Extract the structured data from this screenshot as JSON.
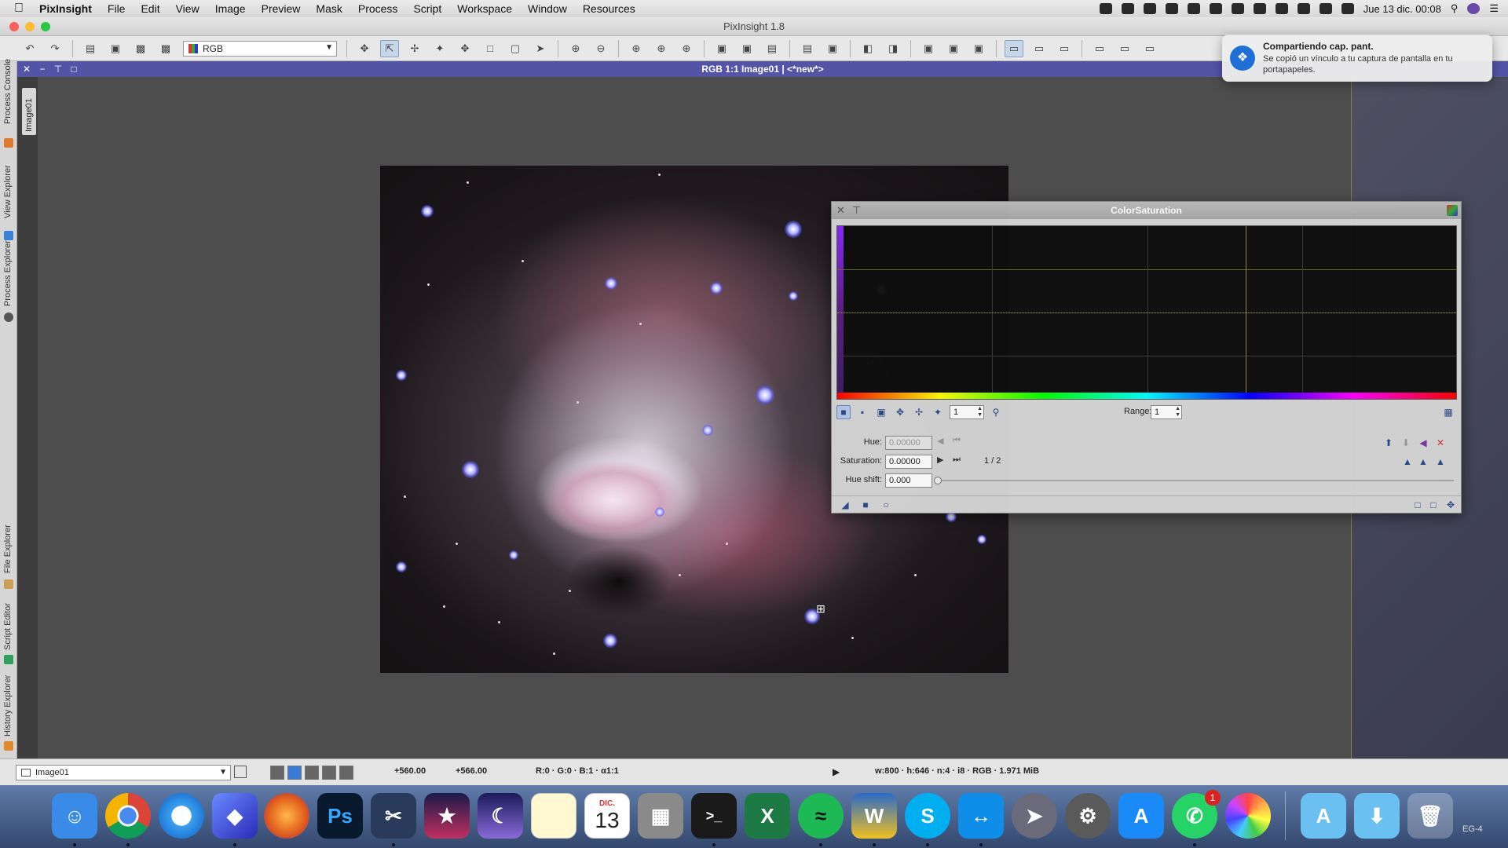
{
  "menubar": {
    "app": "PixInsight",
    "items": [
      "File",
      "Edit",
      "View",
      "Image",
      "Preview",
      "Mask",
      "Process",
      "Script",
      "Workspace",
      "Window",
      "Resources"
    ],
    "clock": "Jue 13 dic.  00:08"
  },
  "window": {
    "title": "PixInsight 1.8"
  },
  "toolbar": {
    "color_mode": "RGB"
  },
  "left_tabs": [
    "Process Console",
    "View Explorer",
    "Process Explorer",
    "File Explorer",
    "Script Editor",
    "History Explorer"
  ],
  "image_tab": "Image01",
  "image_window": {
    "title": "RGB 1:1 Image01 | <*new*>"
  },
  "dialog": {
    "title": "ColorSaturation",
    "zoom_value": "1",
    "range_label": "Range:",
    "range_value": "1",
    "hue_label": "Hue:",
    "hue_value": "0.00000",
    "saturation_label": "Saturation:",
    "saturation_value": "0.00000",
    "point_counter": "1 / 2",
    "hue_shift_label": "Hue shift:",
    "hue_shift_value": "0.000"
  },
  "notification": {
    "title": "Compartiendo cap. pant.",
    "body": "Se copió un vínculo a tu captura de pantalla en tu portapapeles."
  },
  "statusbar": {
    "view": "Image01",
    "x": "+560.00",
    "y": "+566.00",
    "rgb": "R:0 · G:0 · B:1 · α1:1",
    "info": "w:800 · h:646 · n:4 · i8 · RGB · 1.971 MiB"
  },
  "dock": {
    "calendar_month": "DIC.",
    "calendar_day": "13",
    "whatsapp_badge": "1",
    "edge_label": "EG-4"
  }
}
